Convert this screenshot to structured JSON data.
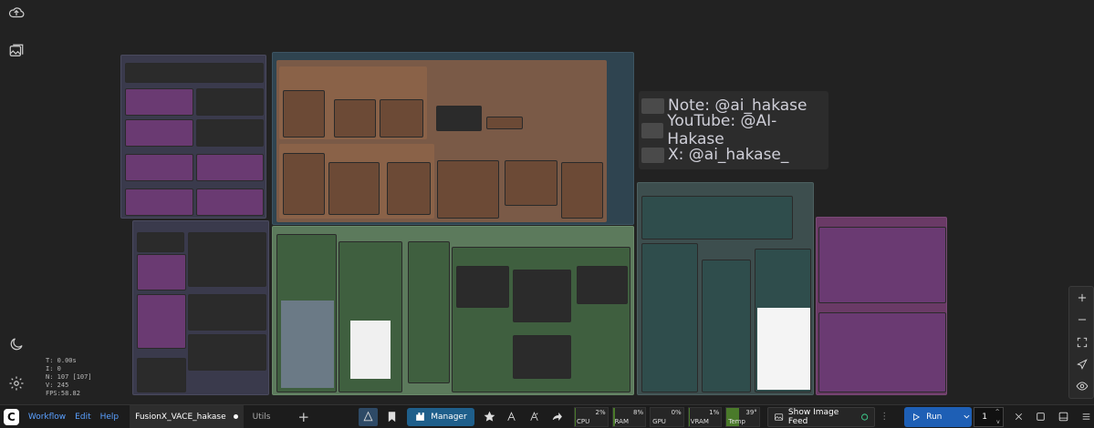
{
  "stats": {
    "t": "T: 0.00s",
    "i": "I: 0",
    "n": "N: 107 [107]",
    "v": "V: 245",
    "fps": "FPS:58.82"
  },
  "note": {
    "lines": [
      "Note: @ai_hakase",
      "YouTube: @AI-Hakase",
      "X: @ai_hakase_"
    ]
  },
  "menu": {
    "workflow": "Workflow",
    "edit": "Edit",
    "help": "Help"
  },
  "tabs": {
    "active": "FusionX_VACE_hakase",
    "other": "Utils"
  },
  "toolbar": {
    "manager": "Manager",
    "show_image_feed": "Show Image Feed",
    "run": "Run",
    "run_count": "1"
  },
  "meters": {
    "cpu": {
      "label": "CPU",
      "value": "2%",
      "level": 0.02
    },
    "ram": {
      "label": "RAM",
      "value": "8%",
      "level": 0.08
    },
    "gpu": {
      "label": "GPU",
      "value": "0%",
      "level": 0.0
    },
    "vram": {
      "label": "VRAM",
      "value": "1%",
      "level": 0.01
    },
    "temp": {
      "label": "Temp",
      "value": "39°",
      "level": 0.39
    }
  },
  "colors": {
    "accent": "#1e5fb5",
    "manager": "#1f5f8b"
  }
}
